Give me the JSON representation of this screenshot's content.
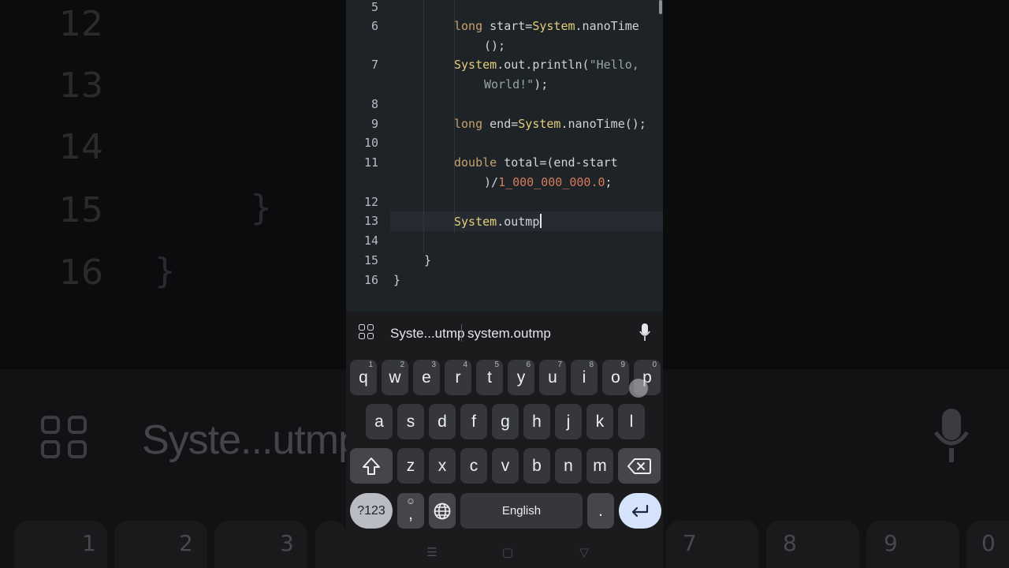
{
  "background": {
    "line_numbers": [
      "12",
      "13",
      "14",
      "15",
      "16"
    ],
    "braces": [
      "}",
      "}"
    ],
    "suggestion": "Syste...utmp",
    "key_hints": [
      "1",
      "2",
      "3",
      "7",
      "8",
      "9",
      "0"
    ]
  },
  "editor": {
    "lines": [
      {
        "number": "5"
      },
      {
        "number": "6",
        "code": "long start=System.nanoTime",
        "cont": "();"
      },
      {
        "number": "7",
        "code": "System.out.println(\"Hello,",
        "cont": "World!\");"
      },
      {
        "number": "8"
      },
      {
        "number": "9",
        "code": "long end=System.nanoTime();"
      },
      {
        "number": "10"
      },
      {
        "number": "11",
        "code": "double total=(end-start",
        "cont": ")/1_000_000_000.0;"
      },
      {
        "number": "12"
      },
      {
        "number": "13",
        "code": "System.outmp"
      },
      {
        "number": "14"
      },
      {
        "number": "15",
        "code": "}"
      },
      {
        "number": "16",
        "code": "}"
      }
    ]
  },
  "keyboard": {
    "suggestions": [
      "Syste...utmp",
      "system.outmp"
    ],
    "icons": {
      "apps": "apps-grid-icon",
      "mic": "microphone-icon",
      "shift": "shift-icon",
      "backspace": "backspace-icon",
      "emoji": "emoji-icon",
      "globe": "globe-icon",
      "enter": "enter-icon"
    },
    "row1": [
      {
        "k": "q",
        "h": "1"
      },
      {
        "k": "w",
        "h": "2"
      },
      {
        "k": "e",
        "h": "3"
      },
      {
        "k": "r",
        "h": "4"
      },
      {
        "k": "t",
        "h": "5"
      },
      {
        "k": "y",
        "h": "6"
      },
      {
        "k": "u",
        "h": "7"
      },
      {
        "k": "i",
        "h": "8"
      },
      {
        "k": "o",
        "h": "9"
      },
      {
        "k": "p",
        "h": "0"
      }
    ],
    "row2": [
      "a",
      "s",
      "d",
      "f",
      "g",
      "h",
      "j",
      "k",
      "l"
    ],
    "row3": [
      "z",
      "x",
      "c",
      "v",
      "b",
      "n",
      "m"
    ],
    "symbols_label": "?123",
    "comma_label": ",",
    "space_label": "English",
    "period_label": ".",
    "colors": {
      "enter": "#d5e3fc",
      "keys": "#35373a",
      "editor_bg": "#1e2328"
    }
  },
  "navbar": {
    "recents": "☰",
    "home": "▢",
    "back": "▽"
  }
}
